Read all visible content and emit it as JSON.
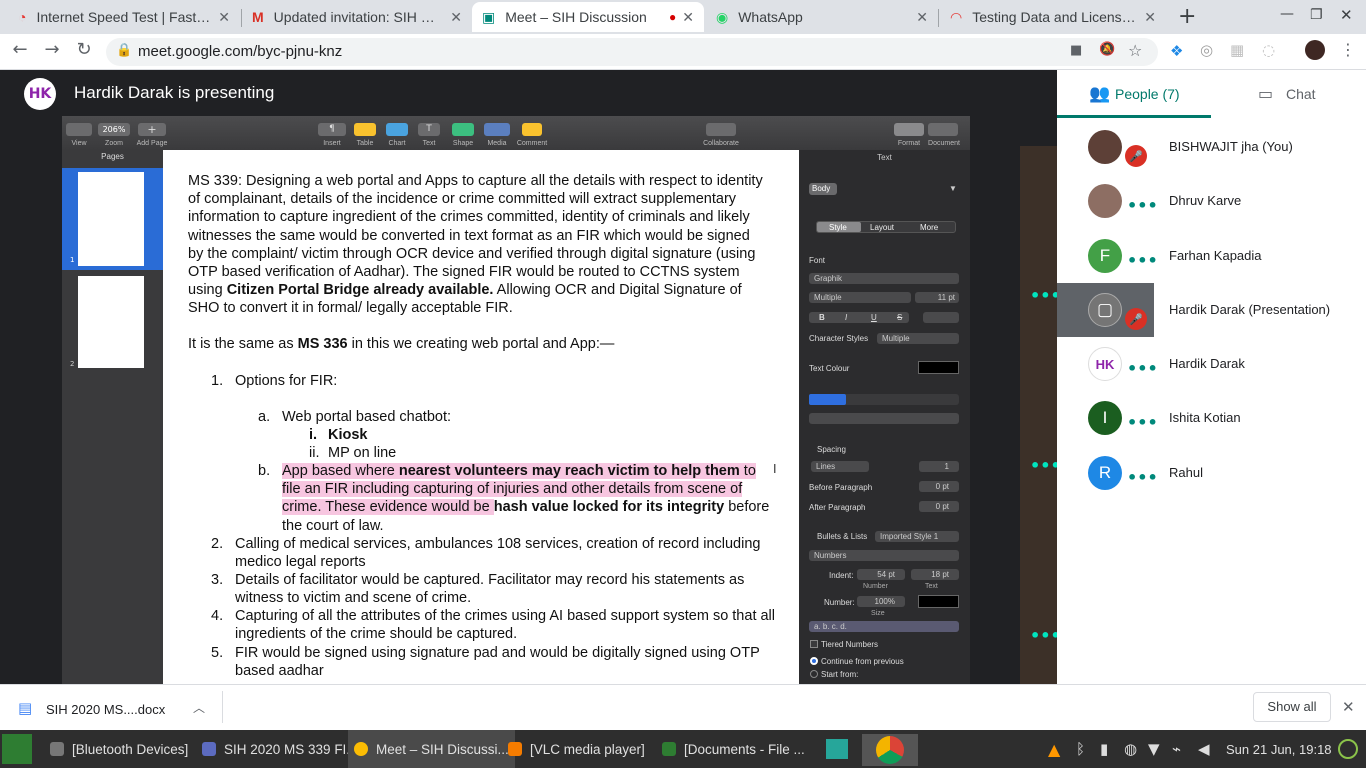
{
  "browser": {
    "tabs": [
      {
        "title": "Internet Speed Test | Fast.com"
      },
      {
        "title": "Updated invitation: SIH Discussion"
      },
      {
        "title": "Meet – SIH Discussion"
      },
      {
        "title": "WhatsApp"
      },
      {
        "title": "Testing Data and License Keys"
      }
    ],
    "url": "meet.google.com/byc-pjnu-knz",
    "new_tab": "+"
  },
  "meet": {
    "presenting": "Hardik Darak is presenting",
    "people_tab": "People (7)",
    "chat_tab": "Chat",
    "participants": [
      {
        "name": "BISHWAJIT jha (You)",
        "initial": "",
        "color": "#5d4037",
        "muted": true
      },
      {
        "name": "Dhruv Karve",
        "initial": "",
        "color": "#8d6e63",
        "muted": false
      },
      {
        "name": "Farhan Kapadia",
        "initial": "F",
        "color": "#43a047",
        "muted": false
      },
      {
        "name": "Hardik Darak (Presentation)",
        "initial": "",
        "color": "#6d6d6d",
        "muted": true
      },
      {
        "name": "Hardik Darak",
        "initial": "",
        "color": "#ffffff",
        "muted": false
      },
      {
        "name": "Ishita Kotian",
        "initial": "I",
        "color": "#1b5e20",
        "muted": false
      },
      {
        "name": "Rahul",
        "initial": "R",
        "color": "#1e88e5",
        "muted": false
      }
    ]
  },
  "pages_app": {
    "toolbar": {
      "view": "View",
      "zoom": "Zoom",
      "zoom_value": "206%",
      "add_page": "Add Page",
      "insert": "Insert",
      "table": "Table",
      "chart": "Chart",
      "text": "Text",
      "shape": "Shape",
      "media": "Media",
      "comment": "Comment",
      "collaborate": "Collaborate",
      "format": "Format",
      "document": "Document"
    },
    "pages_label": "Pages",
    "page_numbers": [
      "1",
      "2"
    ],
    "format_panel": {
      "header": "Text",
      "style": "Body",
      "tabs": [
        "Style",
        "Layout",
        "More"
      ],
      "font_label": "Font",
      "font": "Graphik",
      "font_weight": "Multiple",
      "font_size": "11 pt",
      "bold": "B",
      "italic": "I",
      "underline": "U",
      "strike": "S",
      "char_styles_label": "Character Styles",
      "char_styles": "Multiple",
      "text_colour": "Text Colour",
      "spacing": "Spacing",
      "lines": "Lines",
      "lines_value": "1",
      "before_para": "Before Paragraph",
      "before_val": "0 pt",
      "after_para": "After Paragraph",
      "after_val": "0 pt",
      "bullets": "Bullets & Lists",
      "bullet_style": "Imported Style 1",
      "numbers": "Numbers",
      "indent": "Indent:",
      "indent_num": "54 pt",
      "indent_text": "18 pt",
      "number_lbl": "Number",
      "text_lbl": "Text",
      "number_field": "Number:",
      "number_size": "100%",
      "size_lbl": "Size",
      "numbering": "a. b. c. d.",
      "tiered": "Tiered Numbers",
      "continue": "Continue from previous",
      "start_from": "Start from:"
    }
  },
  "document": {
    "para1": "MS 339: Designing a web portal and Apps to capture all the details with respect to identity of complainant, details of the incidence or crime committed will extract supplementary information to capture ingredient of the crimes committed, identity of criminals and likely witnesses the same would be converted in text format as an FIR which would be signed by the complaint/ victim through OCR device and verified through digital signature (using OTP based verification of Aadhar). The signed FIR would be routed to CCTNS system using ",
    "para1_bold": "Citizen Portal Bridge already available.",
    "para1_end": " Allowing OCR and Digital Signature of SHO to convert it in formal/ legally acceptable FIR.",
    "para2_pre": "It is the same as ",
    "para2_bold": "MS 336",
    "para2_post": " in this we creating web portal and App:—",
    "item1": "Options for FIR:",
    "item1a": "Web portal based chatbot:",
    "item1ai": "Kiosk",
    "item1aii": "MP on line",
    "item1b_pre": "App based where ",
    "item1b_bold": "nearest volunteers may reach victim to help them",
    "item1b_post": " to file an FIR including capturing of injuries and other details from scene of crime. These evidence would be ",
    "item1b_bold2": "hash value locked for its integrity",
    "item1b_end": " before the court of law.",
    "item2": "Calling of medical services, ambulances 108 services, creation of record including medico legal reports",
    "item3": "Details of facilitator would be captured. Facilitator may record his statements as witness to victim and scene of crime.",
    "item4": "Capturing of all the attributes of the crimes using AI based support system so that all ingredients of the crime should be captured.",
    "item5": "FIR would be signed using signature pad and would be digitally signed using OTP based aadhar",
    "n1": "1.",
    "n2": "2.",
    "n3": "3.",
    "n4": "4.",
    "n5": "5.",
    "la": "a.",
    "lb": "b.",
    "li": "i.",
    "lii": "ii."
  },
  "download_bar": {
    "file": "SIH 2020 MS....docx",
    "show_all": "Show all"
  },
  "taskbar": {
    "items": [
      "[Bluetooth Devices]",
      "SIH 2020 MS 339 FI...",
      "Meet – SIH Discussi...",
      "[VLC media player]",
      "[Documents - File ..."
    ],
    "clock": "Sun 21 Jun, 19:18"
  }
}
